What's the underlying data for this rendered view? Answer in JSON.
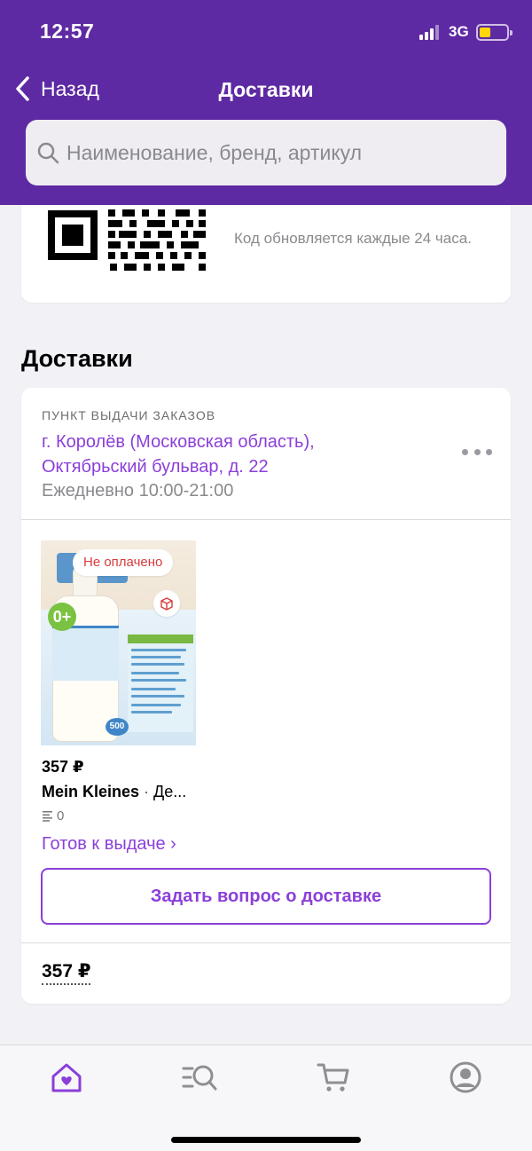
{
  "status_bar": {
    "time": "12:57",
    "network": "3G"
  },
  "nav": {
    "back_label": "Назад",
    "title": "Доставки"
  },
  "search": {
    "placeholder": "Наименование, бренд, артикул"
  },
  "qr_card": {
    "caption": "Код обновляется каждые 24 часа."
  },
  "section_title": "Доставки",
  "delivery": {
    "pickup_label": "ПУНКТ ВЫДАЧИ ЗАКАЗОВ",
    "address": "г. Королёв (Московская область), Октябрьский бульвар, д. 22",
    "hours": "Ежедневно 10:00-21:00",
    "product": {
      "badge": "Не оплачено",
      "price": "357 ₽",
      "brand": "Mein Kleines",
      "separator": " · ",
      "name_truncated": "Де...",
      "feedback_count": "0",
      "status": "Готов к выдаче ›"
    },
    "ask_button": "Задать вопрос о доставке",
    "total": "357 ₽"
  },
  "tabbar": {
    "tabs": [
      {
        "icon": "home-icon",
        "active": true
      },
      {
        "icon": "catalog-search-icon",
        "active": false
      },
      {
        "icon": "cart-icon",
        "active": false
      },
      {
        "icon": "profile-icon",
        "active": false
      }
    ]
  },
  "colors": {
    "header": "#5e2aa3",
    "accent": "#8b3fd9",
    "unpaid": "#d73c3c",
    "battery": "#ffd60a"
  }
}
